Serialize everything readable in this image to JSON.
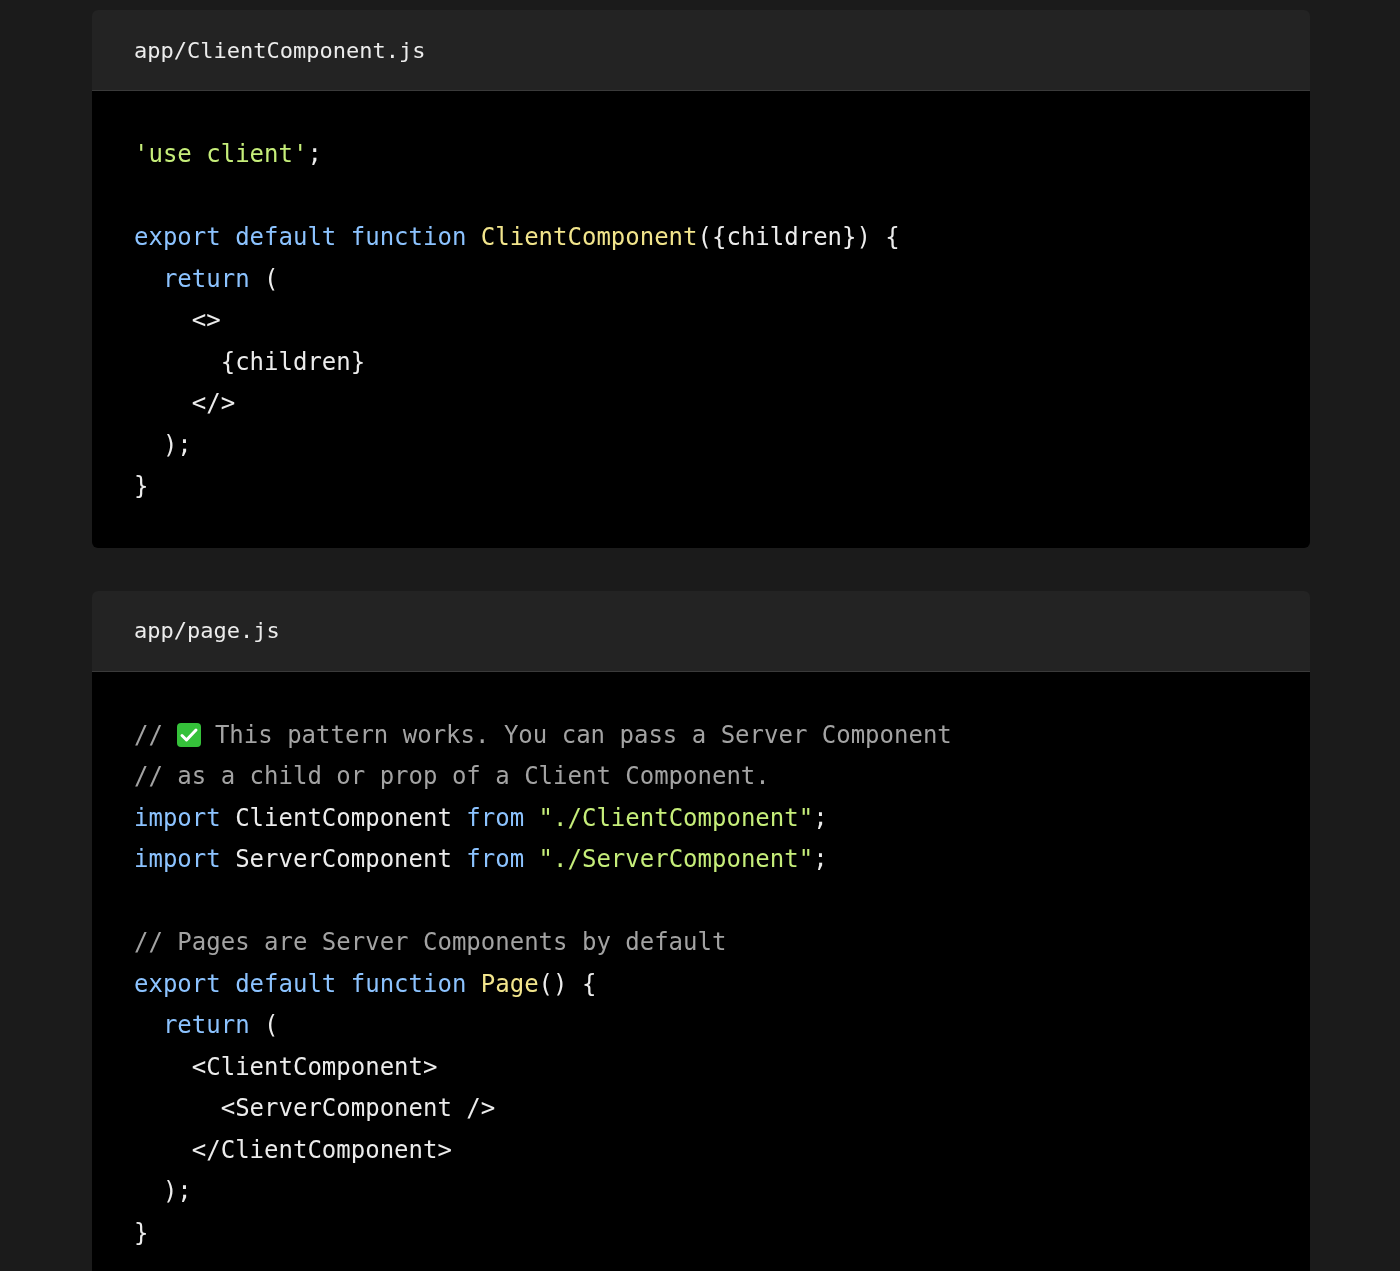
{
  "files": [
    {
      "name": "app/ClientComponent.js",
      "lines": [
        {
          "kind": "code",
          "tokens": [
            {
              "kind": "string",
              "text": "'use client'"
            },
            {
              "kind": "plain",
              "text": ";"
            }
          ]
        },
        {
          "kind": "blank"
        },
        {
          "kind": "code",
          "tokens": [
            {
              "kind": "keyword",
              "text": "export default function "
            },
            {
              "kind": "function",
              "text": "ClientComponent"
            },
            {
              "kind": "plain",
              "text": "({children}) {"
            }
          ]
        },
        {
          "kind": "code",
          "tokens": [
            {
              "kind": "keyword",
              "text": "  return "
            },
            {
              "kind": "plain",
              "text": "("
            }
          ]
        },
        {
          "kind": "code",
          "tokens": [
            {
              "kind": "plain",
              "text": "    <>"
            }
          ]
        },
        {
          "kind": "code",
          "tokens": [
            {
              "kind": "plain",
              "text": "      {children}"
            }
          ]
        },
        {
          "kind": "code",
          "tokens": [
            {
              "kind": "plain",
              "text": "    </>"
            }
          ]
        },
        {
          "kind": "code",
          "tokens": [
            {
              "kind": "plain",
              "text": "  );"
            }
          ]
        },
        {
          "kind": "code",
          "tokens": [
            {
              "kind": "plain",
              "text": "}"
            }
          ]
        }
      ]
    },
    {
      "name": "app/page.js",
      "lines": [
        {
          "kind": "code",
          "tokens": [
            {
              "kind": "comment",
              "text": "//"
            },
            {
              "kind": "icon"
            },
            {
              "kind": "comment",
              "text": "This pattern works. You can pass a Server Component"
            }
          ]
        },
        {
          "kind": "code",
          "tokens": [
            {
              "kind": "comment",
              "text": "// as a child or prop of a Client Component."
            }
          ]
        },
        {
          "kind": "code",
          "tokens": [
            {
              "kind": "keyword",
              "text": "import "
            },
            {
              "kind": "plain",
              "text": "ClientComponent "
            },
            {
              "kind": "keyword",
              "text": "from "
            },
            {
              "kind": "string",
              "text": "\"./ClientComponent\""
            },
            {
              "kind": "plain",
              "text": ";"
            }
          ]
        },
        {
          "kind": "code",
          "tokens": [
            {
              "kind": "keyword",
              "text": "import "
            },
            {
              "kind": "plain",
              "text": "ServerComponent "
            },
            {
              "kind": "keyword",
              "text": "from "
            },
            {
              "kind": "string",
              "text": "\"./ServerComponent\""
            },
            {
              "kind": "plain",
              "text": ";"
            }
          ]
        },
        {
          "kind": "blank"
        },
        {
          "kind": "code",
          "tokens": [
            {
              "kind": "comment",
              "text": "// Pages are Server Components by default"
            }
          ]
        },
        {
          "kind": "code",
          "tokens": [
            {
              "kind": "keyword",
              "text": "export default function "
            },
            {
              "kind": "function",
              "text": "Page"
            },
            {
              "kind": "plain",
              "text": "() {"
            }
          ]
        },
        {
          "kind": "code",
          "tokens": [
            {
              "kind": "keyword",
              "text": "  return "
            },
            {
              "kind": "plain",
              "text": "("
            }
          ]
        },
        {
          "kind": "code",
          "tokens": [
            {
              "kind": "plain",
              "text": "    <ClientComponent>"
            }
          ]
        },
        {
          "kind": "code",
          "tokens": [
            {
              "kind": "plain",
              "text": "      <ServerComponent />"
            }
          ]
        },
        {
          "kind": "code",
          "tokens": [
            {
              "kind": "plain",
              "text": "    </ClientComponent>"
            }
          ]
        },
        {
          "kind": "code",
          "tokens": [
            {
              "kind": "plain",
              "text": "  );"
            }
          ]
        },
        {
          "kind": "code",
          "tokens": [
            {
              "kind": "plain",
              "text": "}"
            }
          ]
        }
      ]
    }
  ]
}
